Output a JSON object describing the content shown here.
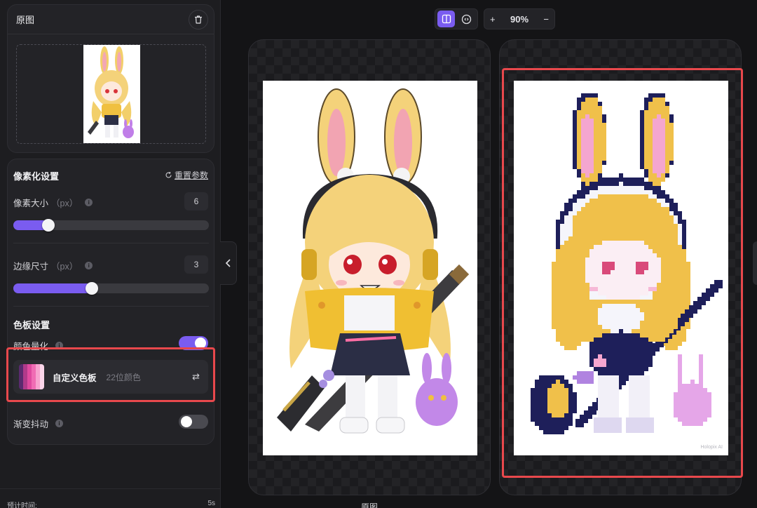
{
  "original_card": {
    "title": "原图",
    "delete_icon": "trash-icon"
  },
  "pixel_settings": {
    "title": "像素化设置",
    "reset_label": "重置参数",
    "pixel_size": {
      "label": "像素大小",
      "unit": "（px）",
      "value": "6",
      "fraction": 0.18
    },
    "edge_size": {
      "label": "边缘尺寸",
      "unit": "（px）",
      "value": "3",
      "fraction": 0.4
    }
  },
  "palette_settings": {
    "title": "色板设置",
    "quantize": {
      "label": "颜色量化",
      "on": true
    },
    "palette": {
      "name": "自定义色板",
      "count": "22位颜色",
      "swap_icon": "⇄",
      "colors": [
        "#5a2a6e",
        "#b03a8a",
        "#e04aa0",
        "#f06cb4",
        "#f7a3cf",
        "#fcd6ea"
      ]
    },
    "dither": {
      "label": "渐变抖动",
      "on": false
    }
  },
  "footer": {
    "label": "预计时间:",
    "value": "5s"
  },
  "toolbar": {
    "compare_icon": "split-view-icon",
    "sync_icon": "sync-icon",
    "zoom_in": "+",
    "zoom": "90%",
    "zoom_out": "−"
  },
  "canvas": {
    "left_label": "原图",
    "watermark": "Holopix AI"
  },
  "colors": {
    "accent": "#7a5cf0",
    "highlight": "#e8484c"
  }
}
